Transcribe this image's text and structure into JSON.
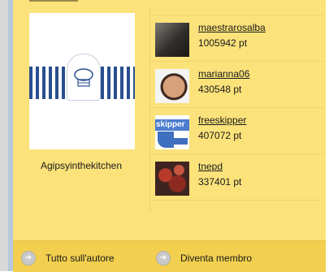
{
  "author": {
    "name": "Agipsyinthekitchen",
    "logo_icon": "kitchen-logo"
  },
  "members": [
    {
      "username": "maestrarosalba",
      "points": "1005942 pt",
      "avatar": "photo-man"
    },
    {
      "username": "marianna06",
      "points": "430548 pt",
      "avatar": "photo-woman"
    },
    {
      "username": "freeskipper",
      "points": "407072 pt",
      "avatar": "skipper-logo",
      "avatar_text": "skipper"
    },
    {
      "username": "tnepd",
      "points": "337401 pt",
      "avatar": "photo-food"
    }
  ],
  "footer": {
    "link1": "Tutto sull'autore",
    "link2": "Diventa membro",
    "link_icon": "arrow-circle-icon"
  }
}
